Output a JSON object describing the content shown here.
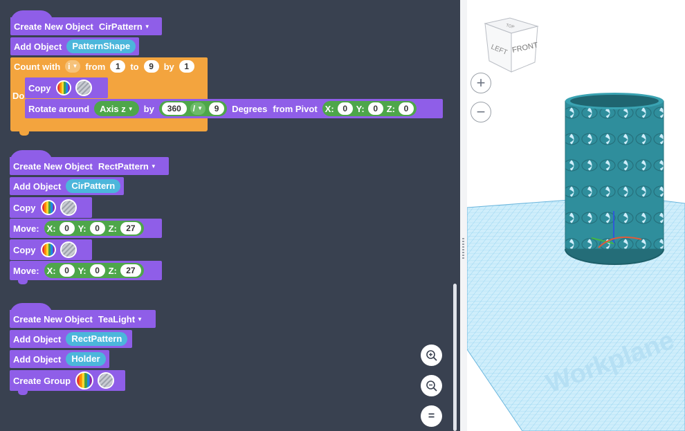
{
  "groups": [
    {
      "header": {
        "prefix": "Create New Object",
        "name": "CirPattern"
      },
      "add": {
        "label": "Add Object",
        "object": "PatternShape"
      },
      "loop": {
        "label": "Count with",
        "var": "i",
        "from_label": "from",
        "from": "1",
        "to_label": "to",
        "to": "9",
        "by_label": "by",
        "by": "1",
        "do_label": "Do",
        "copy_label": "Copy",
        "rotate": {
          "label": "Rotate around",
          "axis": "Axis z",
          "by_label": "by",
          "a": "360",
          "op": "/",
          "b": "9",
          "degrees_label": "Degrees",
          "pivot_label": "from Pivot",
          "x_label": "X:",
          "x": "0",
          "y_label": "Y:",
          "y": "0",
          "z_label": "Z:",
          "z": "0"
        }
      }
    },
    {
      "header": {
        "prefix": "Create New Object",
        "name": "RectPattern"
      },
      "add": {
        "label": "Add Object",
        "object": "CirPattern"
      },
      "copy_label": "Copy",
      "move": {
        "label": "Move:",
        "x_label": "X:",
        "x": "0",
        "y_label": "Y:",
        "y": "0",
        "z_label": "Z:",
        "z": "27"
      }
    },
    {
      "header": {
        "prefix": "Create New Object",
        "name": "TeaLight"
      },
      "add1": {
        "label": "Add Object",
        "object": "RectPattern"
      },
      "add2": {
        "label": "Add Object",
        "object": "Holder"
      },
      "group_label": "Create Group"
    }
  ],
  "zoom_controls": {
    "zoom_in": "zoom-in-icon",
    "zoom_out": "zoom-out-icon",
    "fit": "="
  },
  "viewport": {
    "viewcube": {
      "top": "TOP",
      "left": "LEFT",
      "front": "FRONT"
    },
    "zoom_in": "+",
    "zoom_out": "−",
    "workplane_label": "Workplane",
    "colors": {
      "object": "#2f8e9c",
      "grid": "#8fd0f0",
      "block": "#8f5ee8",
      "loop": "#f3a43e"
    }
  }
}
